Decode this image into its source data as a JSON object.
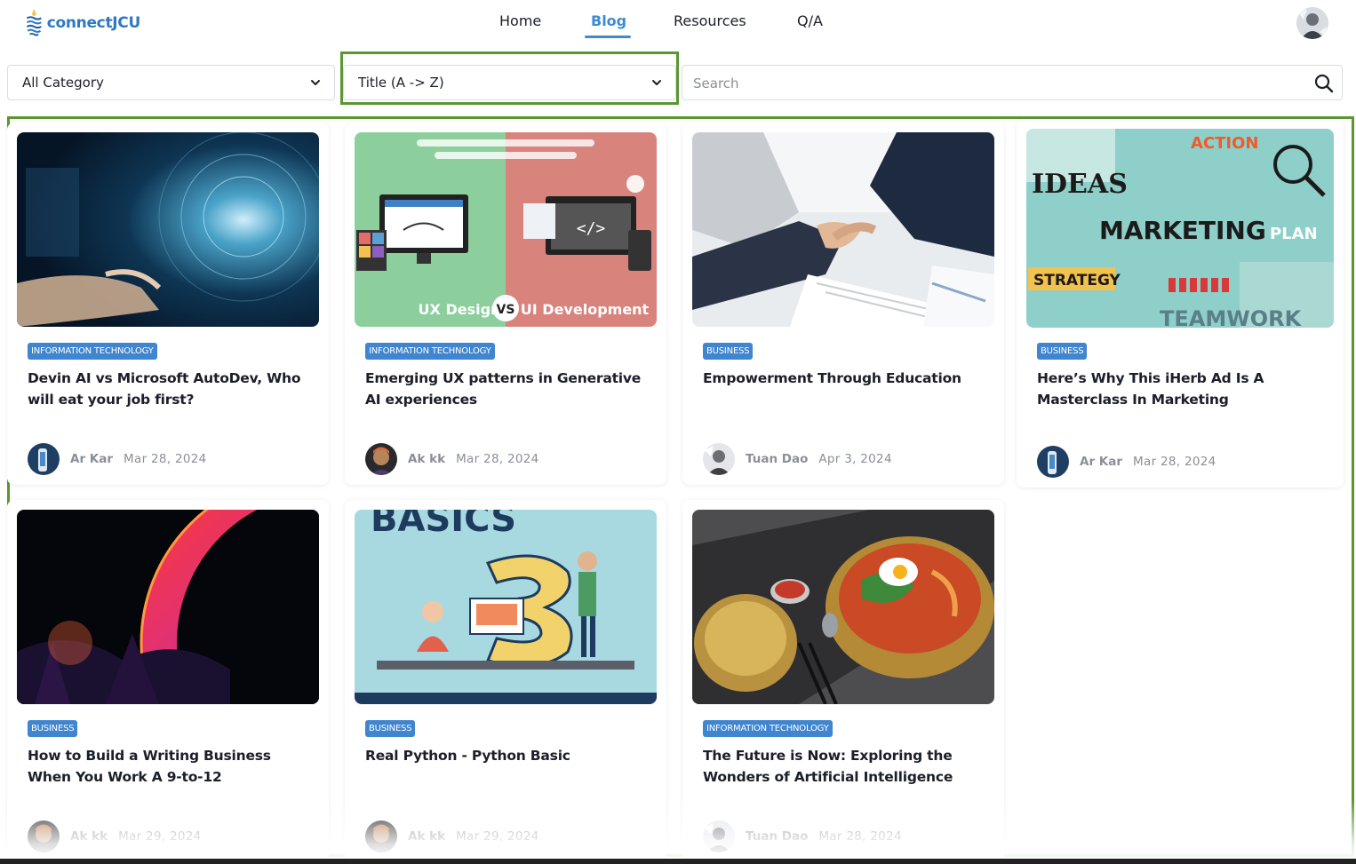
{
  "brand": {
    "name": "connectJCU"
  },
  "nav": {
    "home": "Home",
    "blog": "Blog",
    "resources": "Resources",
    "qa": "Q/A"
  },
  "filters": {
    "category": "All Category",
    "sort": "Title (A -> Z)",
    "search_placeholder": "Search"
  },
  "posts": [
    {
      "category": "INFORMATION TECHNOLOGY",
      "title": "Devin AI vs Microsoft AutoDev, Who will eat your job first?",
      "author": "Ar Kar",
      "date": "Mar 28, 2024"
    },
    {
      "category": "INFORMATION TECHNOLOGY",
      "title": "Emerging UX patterns in Generative AI experiences",
      "author": "Ak kk",
      "date": "Mar 28, 2024",
      "image_text": {
        "left": "UX Design",
        "vs": "VS",
        "right": "UI Development"
      }
    },
    {
      "category": "BUSINESS",
      "title": "Empowerment Through Education",
      "author": "Tuan Dao",
      "date": "Apr 3, 2024"
    },
    {
      "category": "BUSINESS",
      "title": "Here’s Why This iHerb Ad Is A Masterclass In Marketing",
      "author": "Ar Kar",
      "date": "Mar 28, 2024",
      "image_text": {
        "action": "ACTION",
        "ideas": "IDEAS",
        "marketing": "MARKETING",
        "plan": "PLAN",
        "strategy": "STRATEGY",
        "teamwork": "TEAMWORK"
      }
    },
    {
      "category": "BUSINESS",
      "title": "How to Build a Writing Business When You Work A 9-to-12",
      "author": "Ak kk",
      "date": "Mar 29, 2024"
    },
    {
      "category": "BUSINESS",
      "title": "Real Python - Python Basic",
      "author": "Ak kk",
      "date": "Mar 29, 2024",
      "image_text": {
        "basics": "BASICS"
      }
    },
    {
      "category": "INFORMATION TECHNOLOGY",
      "title": "The Future is Now: Exploring the Wonders of Artificial Intelligence",
      "author": "Tuan Dao",
      "date": "Mar 28, 2024"
    }
  ],
  "colors": {
    "accent": "#3d8bd4",
    "badge": "#3f85cf",
    "highlight_outline": "#5a9632"
  },
  "icons": [
    "chevron-down-icon",
    "search-icon",
    "user-avatar"
  ]
}
